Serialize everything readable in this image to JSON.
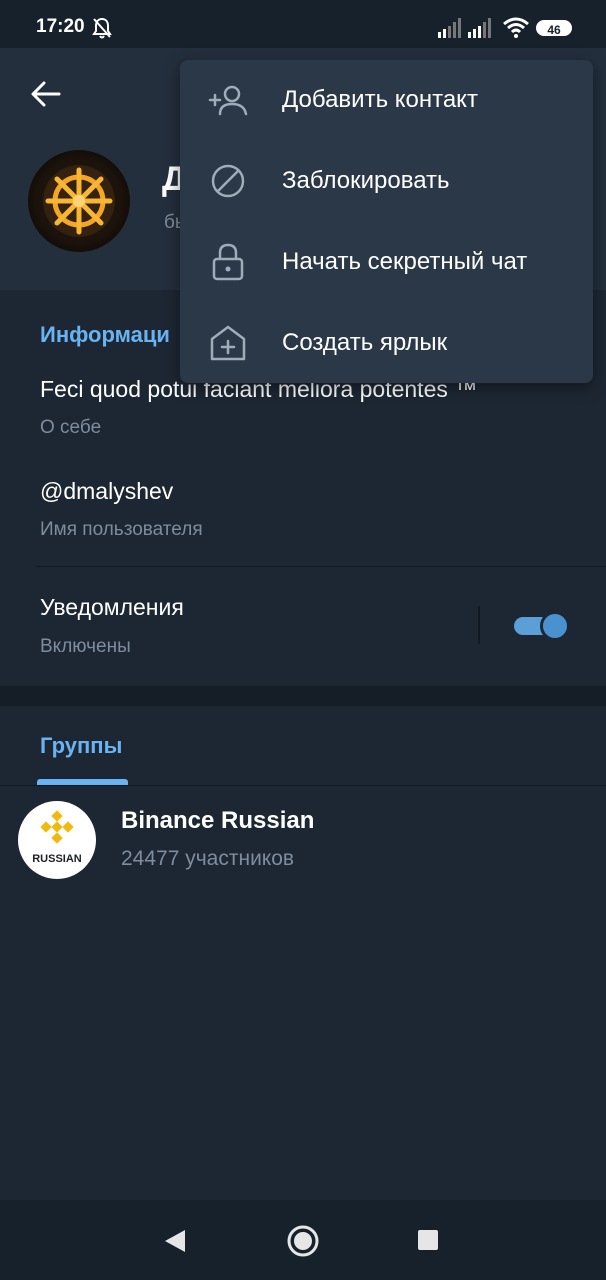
{
  "status_bar": {
    "time": "17:20",
    "battery": "46"
  },
  "profile": {
    "name": "Д",
    "status": "бы"
  },
  "info": {
    "section_title": "Информаци",
    "bio": "Feci quod potui faciant meliora potentes ™",
    "bio_label": "О себе",
    "username": "@dmalyshev",
    "username_label": "Имя пользователя",
    "notifications": "Уведомления",
    "notifications_state": "Включены",
    "notifications_enabled": true
  },
  "groups": {
    "tab_label": "Группы",
    "items": [
      {
        "name": "Binance Russian",
        "members": "24477 участников",
        "avatar_text": "RUSSIAN"
      }
    ]
  },
  "menu": {
    "items": [
      {
        "label": "Добавить контакт",
        "icon": "add-contact-icon"
      },
      {
        "label": "Заблокировать",
        "icon": "block-icon"
      },
      {
        "label": "Начать секретный чат",
        "icon": "lock-icon"
      },
      {
        "label": "Создать ярлык",
        "icon": "add-shortcut-icon"
      }
    ]
  },
  "colors": {
    "background": "#1d2733",
    "header": "#242f3d",
    "menu": "#2b3847",
    "accent": "#6ab3f3",
    "secondary_text": "#7e8c9b",
    "binance_yellow": "#f0b90b"
  }
}
